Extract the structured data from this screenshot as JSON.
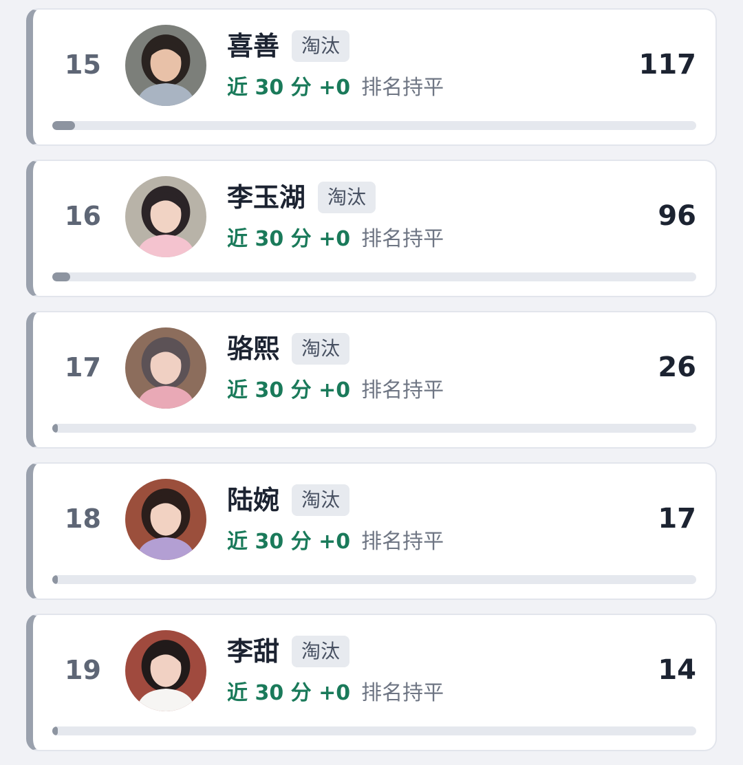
{
  "rows": [
    {
      "rank": "15",
      "name": "喜善",
      "tag": "淘汰",
      "trend": "近 30 分 +0",
      "rank_status": "排名持平",
      "score": "117",
      "progress_fraction": 0.035,
      "avatar_colors": {
        "bg": "#7c7f7a",
        "hair": "#2a2320",
        "face": "#e8c1a8",
        "cloth": "#a9b4c2"
      }
    },
    {
      "rank": "16",
      "name": "李玉湖",
      "tag": "淘汰",
      "trend": "近 30 分 +0",
      "rank_status": "排名持平",
      "score": "96",
      "progress_fraction": 0.028,
      "avatar_colors": {
        "bg": "#b8b3a8",
        "hair": "#2b2427",
        "face": "#f1d3c4",
        "cloth": "#f4c3cf"
      }
    },
    {
      "rank": "17",
      "name": "骆熙",
      "tag": "淘汰",
      "trend": "近 30 分 +0",
      "rank_status": "排名持平",
      "score": "26",
      "progress_fraction": 0.008,
      "avatar_colors": {
        "bg": "#8c6d5c",
        "hair": "#5c5256",
        "face": "#f0d0c3",
        "cloth": "#e9a9b6"
      }
    },
    {
      "rank": "18",
      "name": "陆婉",
      "tag": "淘汰",
      "trend": "近 30 分 +0",
      "rank_status": "排名持平",
      "score": "17",
      "progress_fraction": 0.006,
      "avatar_colors": {
        "bg": "#9b4f3c",
        "hair": "#2b1e1b",
        "face": "#f2d2c2",
        "cloth": "#b39fd3"
      }
    },
    {
      "rank": "19",
      "name": "李甜",
      "tag": "淘汰",
      "trend": "近 30 分 +0",
      "rank_status": "排名持平",
      "score": "14",
      "progress_fraction": 0.005,
      "avatar_colors": {
        "bg": "#a04a3e",
        "hair": "#211a1a",
        "face": "#f1d1c3",
        "cloth": "#f6f5f3"
      }
    }
  ]
}
